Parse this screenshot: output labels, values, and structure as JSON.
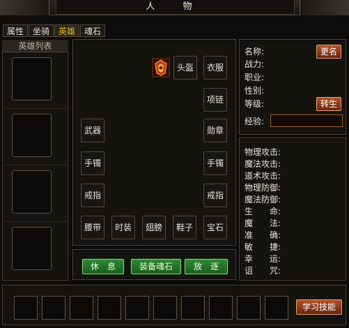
{
  "window": {
    "title": "人 物"
  },
  "tabs": [
    {
      "label": "属性"
    },
    {
      "label": "坐骑"
    },
    {
      "label": "英雄"
    },
    {
      "label": "魂石"
    }
  ],
  "hero_list": {
    "title": "英雄列表"
  },
  "equipment": {
    "helmet": "头盔",
    "clothes": "衣服",
    "necklace": "项链",
    "weapon": "武器",
    "medal": "勋章",
    "bracelet_left": "手镯",
    "bracelet_right": "手镯",
    "ring_left": "戒指",
    "ring_right": "戒指",
    "belt": "腰带",
    "fashion": "时装",
    "wings": "翅膀",
    "shoes": "鞋子",
    "gem": "宝石"
  },
  "actions": {
    "rest": "休　息",
    "equip_soulstone": "装备魂石",
    "dismiss": "放　逐"
  },
  "info": {
    "name_label": "名称:",
    "power_label": "战力:",
    "job_label": "职业:",
    "gender_label": "性别:",
    "level_label": "等级:",
    "exp_label": "经验:",
    "rename_button": "更名",
    "rebirth_button": "转生"
  },
  "stats": [
    "物理攻击:",
    "魔法攻击:",
    "道术攻击:",
    "物理防御:",
    "魔法防御:",
    "生　　命:",
    "魔　　法:",
    "准　　确:",
    "敏　　捷:",
    "幸　　运:",
    "诅　　咒:"
  ],
  "skills": {
    "learn_button": "学习技能"
  },
  "colors": {
    "tab_active": "#e7b42c",
    "green_button": "#2f8a33",
    "orange_button": "#b2532a"
  }
}
